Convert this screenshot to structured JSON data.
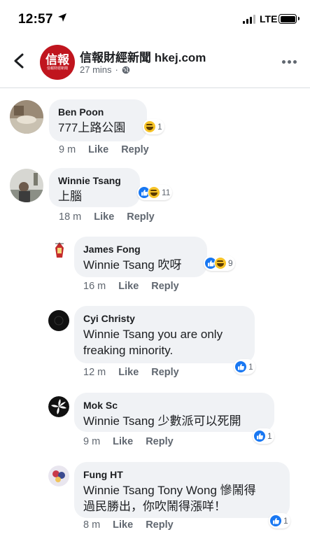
{
  "status_bar": {
    "time": "12:57",
    "network": "LTE"
  },
  "post_header": {
    "page_name": "信報財經新聞 hkej.com",
    "time": "27 mins",
    "logo_text": "信報",
    "logo_subtext": "信報財經新聞"
  },
  "labels": {
    "like": "Like",
    "reply": "Reply"
  },
  "comments": [
    {
      "author": "Ben Poon",
      "text": "777上路公園",
      "time": "9 m",
      "reaction_count": "1"
    },
    {
      "author": "Winnie  Tsang",
      "text": "上腦",
      "time": "18 m",
      "reaction_count": "11"
    },
    {
      "author": "James Fong",
      "text": "Winnie  Tsang 吹呀",
      "time": "16 m",
      "reaction_count": "9"
    },
    {
      "author": "Cyi Christy",
      "text_line1": "Winnie  Tsang  you are only",
      "text_line2": "freaking minority.",
      "time": "12 m",
      "reaction_count": "1"
    },
    {
      "author": "Mok Sc",
      "text": "Winnie  Tsang 少數派可以死開",
      "time": "9 m",
      "reaction_count": "1"
    },
    {
      "author": "Fung HT",
      "text_line1": "Winnie  Tsang Tony Wong 慘鬧得",
      "text_line2": "過民勝出，你吹鬧得漲咩！",
      "time": "8 m",
      "reaction_count": "1"
    }
  ],
  "colors": {
    "brand_red": "#c0151e",
    "like_blue": "#1877f2",
    "haha_yellow": "#f7c428",
    "bubble_grey": "#f0f2f5"
  }
}
